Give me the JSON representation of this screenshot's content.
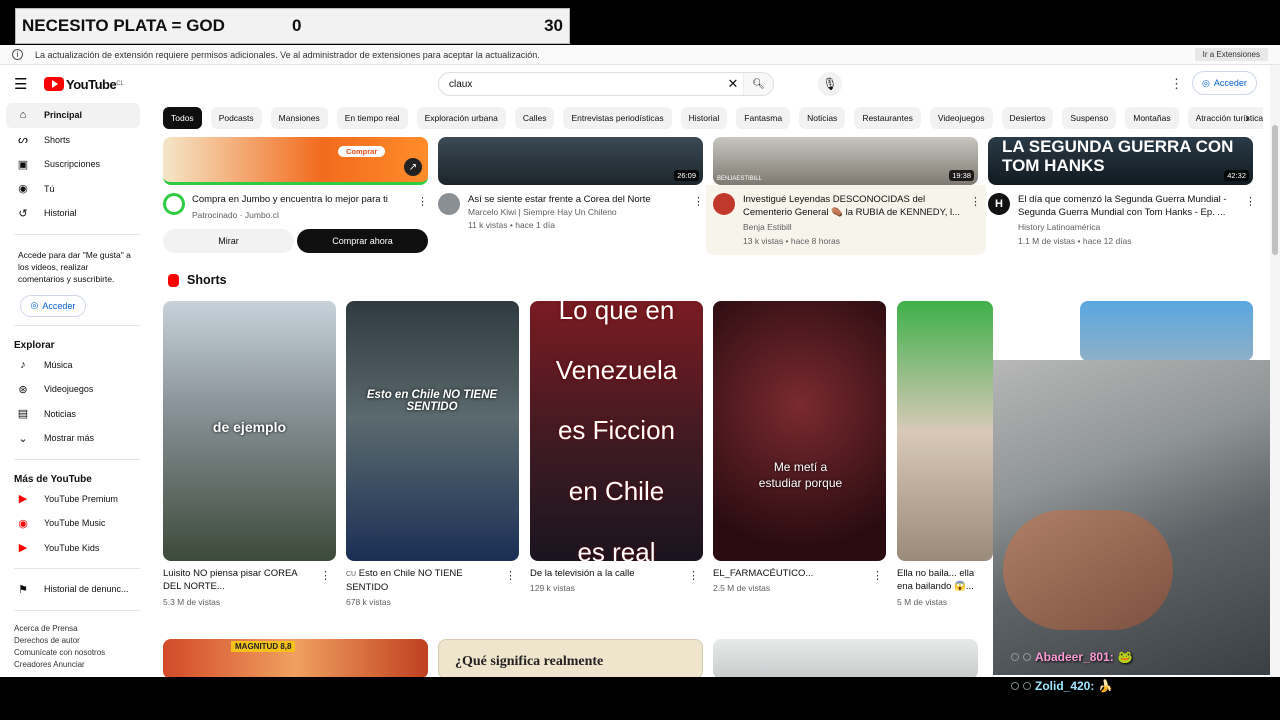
{
  "overlay": {
    "title": "NECESITO PLATA = GOD",
    "count_a": "0",
    "count_b": "30"
  },
  "infobar": {
    "message": "La actualización de extensión requiere permisos adicionales. Ve al administrador de extensiones para aceptar la actualización.",
    "button": "Ir a Extensiones"
  },
  "header": {
    "logo": "YouTube",
    "logo_region": "CL",
    "search_value": "claux",
    "signin": "Acceder"
  },
  "sidebar": {
    "items": [
      "Principal",
      "Shorts",
      "Suscripciones",
      "Tú",
      "Historial"
    ],
    "note": "Accede para dar \"Me gusta\" a los videos, realizar comentarios y suscribirte.",
    "signin": "Acceder",
    "explore_title": "Explorar",
    "explore": [
      "Música",
      "Videojuegos",
      "Noticias",
      "Mostrar más"
    ],
    "more_title": "Más de YouTube",
    "more": [
      "YouTube Premium",
      "YouTube Music",
      "YouTube Kids"
    ],
    "report": "Historial de denunc...",
    "footer": [
      "Acerca de  Prensa",
      "Derechos de autor",
      "Comunícate con nosotros",
      "Creadores  Anunciar"
    ]
  },
  "chips": [
    "Todos",
    "Podcasts",
    "Mansiones",
    "En tiempo real",
    "Exploración urbana",
    "Calles",
    "Entrevistas periodísticas",
    "Historial",
    "Fantasma",
    "Noticias",
    "Restaurantes",
    "Videojuegos",
    "Desiertos",
    "Suspenso",
    "Montañas",
    "Atracción turística"
  ],
  "videos": [
    {
      "title": "Compra en Jumbo y encuentra lo mejor para ti",
      "channel": "Patrocinado · Jumbo.cl",
      "thumb_text": "Comprar",
      "btn1": "Mirar",
      "btn2": "Comprar ahora"
    },
    {
      "title": "Así se siente estar frente a Corea del Norte",
      "channel": "Marcelo Kiwi | Siempre Hay Un Chileno",
      "meta": "11 k vistas • hace 1 día",
      "duration": "26:09"
    },
    {
      "title": "Investigué Leyendas DESCONOCIDAS del Cementerio General ⚰️ la RUBIA de KENNEDY, l...",
      "channel": "Benja Estibill",
      "meta": "13 k vistas • hace 8 horas",
      "duration": "19:38",
      "thumb_text": "BENJAESTIBILL"
    },
    {
      "title": "El día que comenzó la Segunda Guerra Mundial - Segunda Guerra Mundial con Tom Hanks - Ep. ...",
      "channel": "History Latinoamérica",
      "meta": "1.1 M de vistas • hace 12 días",
      "duration": "42:32",
      "thumb_text": "LA SEGUNDA GUERRA CON TOM HANKS"
    }
  ],
  "shorts_title": "Shorts",
  "shorts": [
    {
      "title": "Luisito NO piensa pisar COREA DEL NORTE...",
      "views": "5.3 M de vistas",
      "overlay": "de ejemplo"
    },
    {
      "title": "Esto en Chile NO TIENE SENTIDO",
      "views": "678 k vistas",
      "overlay": "Esto en Chile NO TIENE SENTIDO",
      "prefix": "CU"
    },
    {
      "title": "De la televisión a la calle",
      "views": "129 k vistas",
      "overlay_lines": [
        "Lo que en",
        "Venezuela",
        "es Ficcion",
        "en Chile",
        "es real"
      ]
    },
    {
      "title": "EL_FARMACÉUTICO...",
      "views": "2.5 M de vistas",
      "overlay": "Me metí a estudiar porque"
    },
    {
      "title": "Ella no baila... ella ena bailando 😱...",
      "views": "5 M de vistas"
    }
  ],
  "bottom_row": {
    "thumb1": "MAGNITUD 8,8",
    "thumb2": "¿Qué significa realmente"
  },
  "chat": [
    {
      "user": "Abadeer_801:",
      "msg": "🐸"
    },
    {
      "user": "Zolid_420:",
      "msg": "🍌"
    }
  ],
  "colors": {
    "accent": "#065fd4",
    "brand": "#ff0000"
  }
}
